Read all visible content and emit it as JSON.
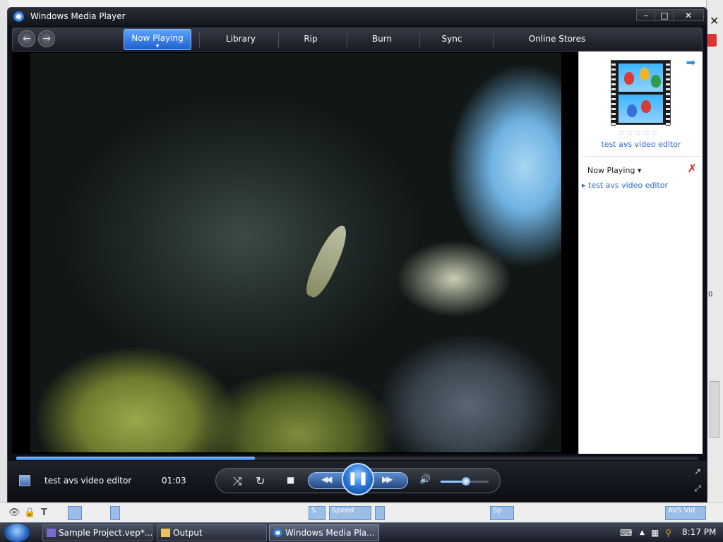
{
  "window": {
    "title": "Windows Media Player",
    "minimize_label": "–",
    "maximize_label": "□",
    "close_label": "✕"
  },
  "nav": {
    "back_label": "←",
    "forward_label": "→",
    "tabs": [
      {
        "label": "Now Playing",
        "active": true
      },
      {
        "label": "Library"
      },
      {
        "label": "Rip"
      },
      {
        "label": "Burn"
      },
      {
        "label": "Sync"
      },
      {
        "label": "Online Stores"
      }
    ],
    "active_arrow": "▼"
  },
  "right_pane": {
    "forward_icon": "➡",
    "rating_stars": "☆☆☆☆☆",
    "media_title": "test avs video editor",
    "playlist_label": "Now Playing",
    "playlist_dropdown": "▾",
    "clear_icon": "✗",
    "items": [
      {
        "label": "▸ test avs video editor"
      }
    ]
  },
  "player": {
    "progress_fraction": 0.35,
    "title": "test avs video editor",
    "time": "01:03",
    "volume_fraction": 0.5,
    "shuffle_icon": "⤨",
    "repeat_icon": "↻",
    "stop_icon": "■",
    "rewind_icon": "◀◀",
    "pause_icon": "❚❚",
    "forward_icon": "▶▶",
    "mute_icon": "🔊",
    "switch_to_compact_icon": "↗",
    "fullscreen_icon": "⤢"
  },
  "taskbar": {
    "tasks": [
      {
        "label": "Sample Project.vep*...",
        "active": false
      },
      {
        "label": "Output",
        "active": false
      },
      {
        "label": "Windows Media Pla...",
        "active": true
      }
    ],
    "clock": "8:17 PM"
  },
  "background_app": {
    "close_label": "✕",
    "side_label": "0",
    "bottom_labels": [
      "S",
      "Speed",
      "Sp",
      "AVS Vid"
    ]
  },
  "colors": {
    "accent": "#2f7de0",
    "link": "#2b66c9",
    "window_bg": "#0c0f17"
  }
}
